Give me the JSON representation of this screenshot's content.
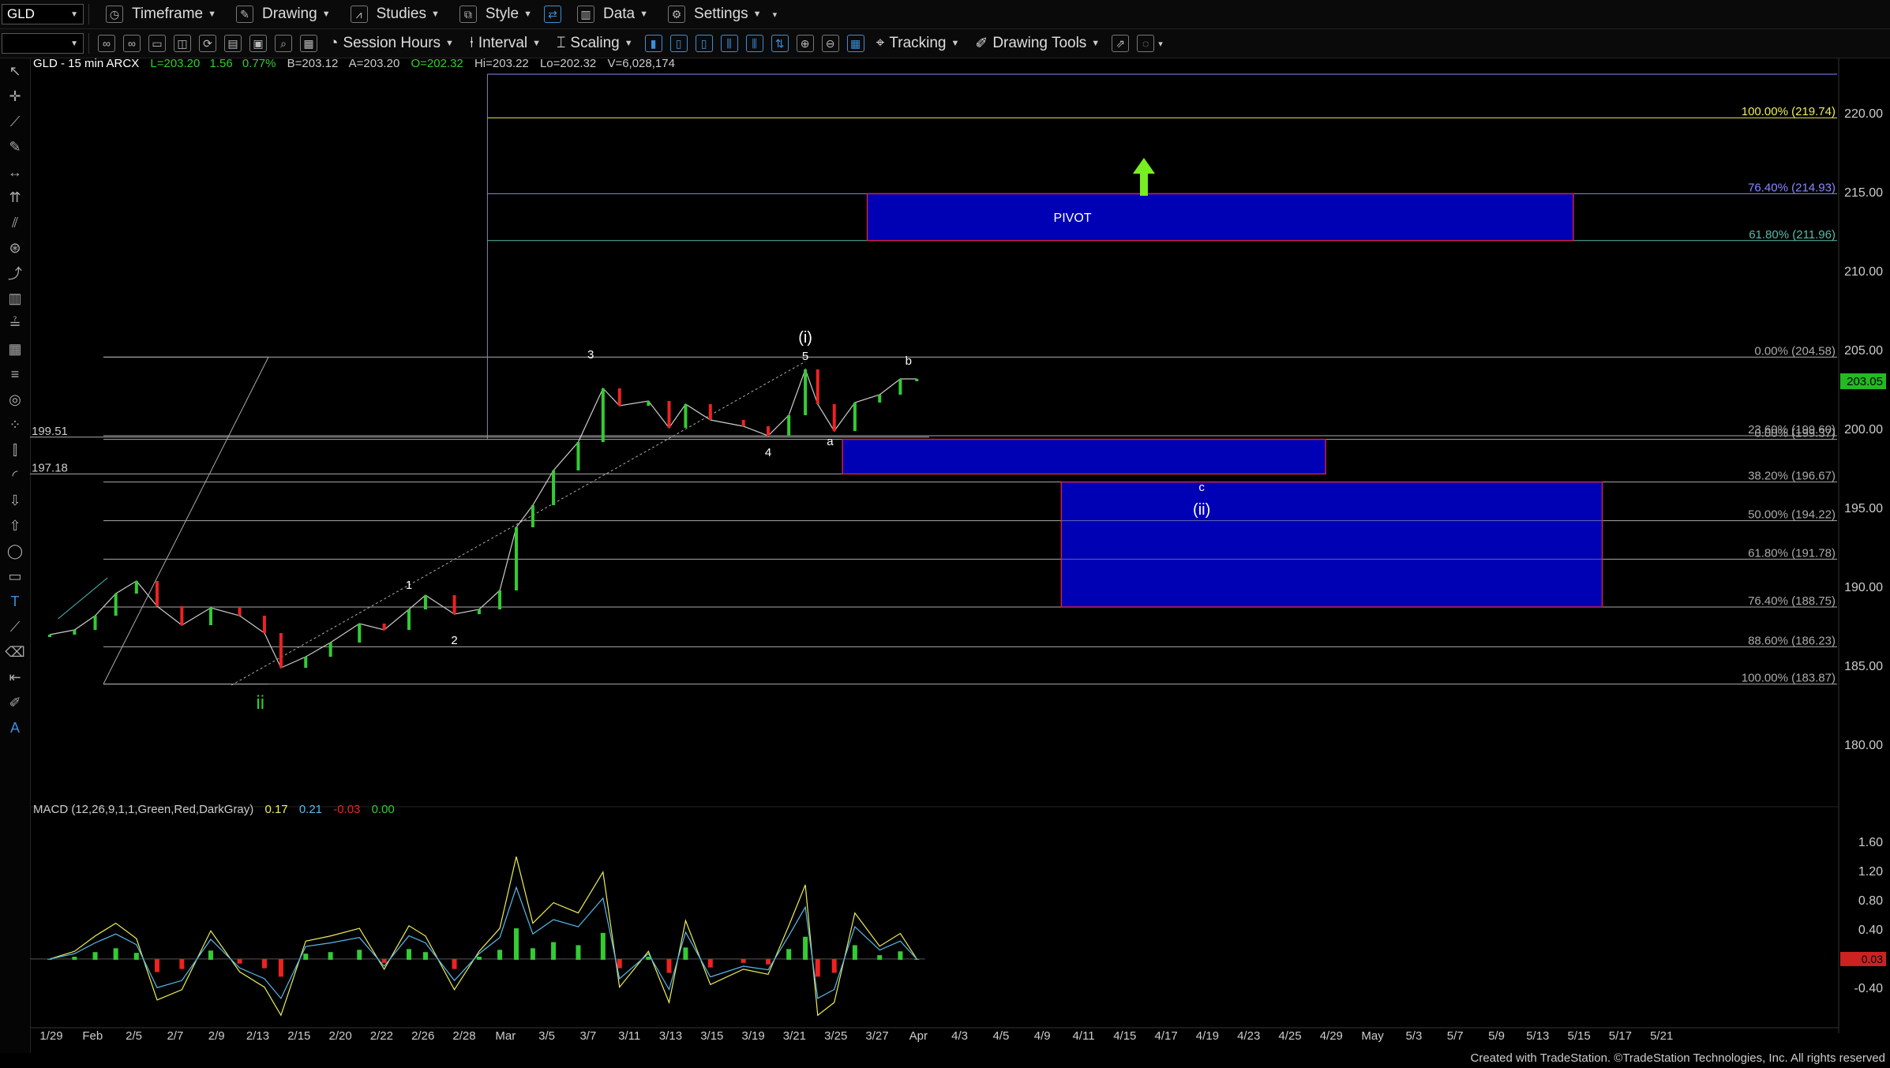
{
  "toolbar1": {
    "symbol": "GLD",
    "items": [
      "Timeframe",
      "Drawing",
      "Studies",
      "Style",
      "Data",
      "Settings"
    ]
  },
  "toolbar2": {
    "items": [
      "Session Hours",
      "Interval",
      "Scaling",
      "Tracking",
      "Drawing Tools"
    ]
  },
  "header": {
    "symbol_line": "GLD - 15 min  ARCX",
    "last": "L=203.20",
    "change": "1.56",
    "change_pct": "0.77%",
    "bid": "B=203.12",
    "ask": "A=203.20",
    "open": "O=202.32",
    "high": "Hi=203.22",
    "low": "Lo=202.32",
    "volume": "V=6,028,174"
  },
  "macd_header": {
    "label": "MACD (12,26,9,1,1,Green,Red,DarkGray)",
    "v1": "0.17",
    "v2": "0.21",
    "v3": "-0.03",
    "v4": "0.00"
  },
  "footer": "Created with TradeStation. ©TradeStation Technologies, Inc. All rights reserved",
  "colors": {
    "up": "#33cc33",
    "down": "#ee2222",
    "accent": "#3b8fd9",
    "box": "#0000b4"
  },
  "chart_data": {
    "type": "line",
    "title": "GLD - 15 min",
    "x_ticks": [
      "1/29",
      "Feb",
      "2/5",
      "2/7",
      "2/9",
      "2/13",
      "2/15",
      "2/20",
      "2/22",
      "2/26",
      "2/28",
      "Mar",
      "3/5",
      "3/7",
      "3/11",
      "3/13",
      "3/15",
      "3/19",
      "3/21",
      "3/25",
      "3/27",
      "Apr",
      "4/3",
      "4/5",
      "4/9",
      "4/11",
      "4/15",
      "4/17",
      "4/19",
      "4/23",
      "4/25",
      "4/29",
      "May",
      "5/3",
      "5/7",
      "5/9",
      "5/13",
      "5/15",
      "5/17",
      "5/21"
    ],
    "y_ticks": [
      220.0,
      215.0,
      210.0,
      205.0,
      200.0,
      195.0,
      190.0,
      185.0,
      180.0
    ],
    "ylim": [
      176.5,
      223.5
    ],
    "macd_ticks": [
      1.6,
      1.2,
      0.8,
      0.4,
      0.0,
      -0.4
    ],
    "macd_ylim": [
      -0.8,
      1.9
    ],
    "last_price_label": "203.05",
    "macd_last_label": "0.03",
    "price_series": [
      {
        "x": 0,
        "y": 187.0
      },
      {
        "x": 0.6,
        "y": 187.3
      },
      {
        "x": 1.1,
        "y": 188.2
      },
      {
        "x": 1.6,
        "y": 189.6
      },
      {
        "x": 2.1,
        "y": 190.4
      },
      {
        "x": 2.6,
        "y": 188.8
      },
      {
        "x": 3.2,
        "y": 187.6
      },
      {
        "x": 3.9,
        "y": 188.7
      },
      {
        "x": 4.6,
        "y": 188.2
      },
      {
        "x": 5.2,
        "y": 187.1
      },
      {
        "x": 5.6,
        "y": 184.9
      },
      {
        "x": 6.2,
        "y": 185.6
      },
      {
        "x": 6.8,
        "y": 186.5
      },
      {
        "x": 7.5,
        "y": 187.7
      },
      {
        "x": 8.1,
        "y": 187.3
      },
      {
        "x": 8.7,
        "y": 188.6
      },
      {
        "x": 9.1,
        "y": 189.5
      },
      {
        "x": 9.8,
        "y": 188.3
      },
      {
        "x": 10.4,
        "y": 188.6
      },
      {
        "x": 10.9,
        "y": 189.8
      },
      {
        "x": 11.3,
        "y": 193.8
      },
      {
        "x": 11.7,
        "y": 195.2
      },
      {
        "x": 12.2,
        "y": 197.4
      },
      {
        "x": 12.8,
        "y": 199.2
      },
      {
        "x": 13.4,
        "y": 202.6
      },
      {
        "x": 13.8,
        "y": 201.5
      },
      {
        "x": 14.5,
        "y": 201.8
      },
      {
        "x": 15.0,
        "y": 200.1
      },
      {
        "x": 15.4,
        "y": 201.6
      },
      {
        "x": 16.0,
        "y": 200.6
      },
      {
        "x": 16.8,
        "y": 200.2
      },
      {
        "x": 17.4,
        "y": 199.6
      },
      {
        "x": 17.9,
        "y": 200.9
      },
      {
        "x": 18.3,
        "y": 203.8
      },
      {
        "x": 18.6,
        "y": 201.6
      },
      {
        "x": 19.0,
        "y": 199.9
      },
      {
        "x": 19.5,
        "y": 201.7
      },
      {
        "x": 20.1,
        "y": 202.2
      },
      {
        "x": 20.6,
        "y": 203.2
      },
      {
        "x": 21.0,
        "y": 203.2
      }
    ],
    "fib_levels": [
      {
        "label": "100.00% (219.74)",
        "value": 219.74,
        "color": "#eeee55"
      },
      {
        "label": "76.40% (214.93)",
        "value": 214.93,
        "color": "#8888ff"
      },
      {
        "label": "61.80% (211.96)",
        "value": 211.96,
        "color": "#55bbaa"
      },
      {
        "label": "0.00% (204.58)",
        "value": 204.58,
        "color": "#aaaaaa"
      },
      {
        "label": "23.60% (199.60)",
        "value": 199.6,
        "color": "#aaaaaa"
      },
      {
        "label": "0.00% (199.37)",
        "value": 199.37,
        "color": "#aaaaaa"
      },
      {
        "label": "38.20% (196.67)",
        "value": 196.67,
        "color": "#aaaaaa"
      },
      {
        "label": "50.00% (194.22)",
        "value": 194.22,
        "color": "#aaaaaa"
      },
      {
        "label": "61.80% (191.78)",
        "value": 191.78,
        "color": "#aaaaaa"
      },
      {
        "label": "76.40% (188.75)",
        "value": 188.75,
        "color": "#aaaaaa"
      },
      {
        "label": "88.60% (186.23)",
        "value": 186.23,
        "color": "#aaaaaa"
      },
      {
        "label": "100.00% (183.87)",
        "value": 183.87,
        "color": "#aaaaaa"
      }
    ],
    "left_levels": [
      {
        "label": "199.51",
        "value": 199.51
      },
      {
        "label": "197.18",
        "value": 197.18
      }
    ],
    "zones": [
      {
        "label": "PIVOT",
        "x0": 19.8,
        "x1": 36.9,
        "y0": 211.96,
        "y1": 214.93
      },
      {
        "label": "",
        "x0": 19.2,
        "x1": 30.9,
        "y0": 197.18,
        "y1": 199.37
      },
      {
        "label": "",
        "x0": 24.5,
        "x1": 37.6,
        "y0": 188.75,
        "y1": 196.67
      }
    ],
    "annotations": [
      {
        "text": "3",
        "x": 13.1,
        "y": 204.5,
        "color": "#ffffff",
        "size": 15
      },
      {
        "text": "(i)",
        "x": 18.3,
        "y": 205.5,
        "color": "#ffffff",
        "size": 20
      },
      {
        "text": "5",
        "x": 18.3,
        "y": 204.4,
        "color": "#ffffff",
        "size": 15
      },
      {
        "text": "b",
        "x": 20.8,
        "y": 204.1,
        "color": "#ffffff",
        "size": 15
      },
      {
        "text": "4",
        "x": 17.4,
        "y": 198.3,
        "color": "#ffffff",
        "size": 15
      },
      {
        "text": "a",
        "x": 18.9,
        "y": 199.0,
        "color": "#ffffff",
        "size": 15
      },
      {
        "text": "1",
        "x": 8.7,
        "y": 189.9,
        "color": "#ffffff",
        "size": 15
      },
      {
        "text": "2",
        "x": 9.8,
        "y": 186.4,
        "color": "#ffffff",
        "size": 15
      },
      {
        "text": "ii",
        "x": 5.1,
        "y": 182.3,
        "color": "#33cc33",
        "size": 24
      },
      {
        "text": "c",
        "x": 27.9,
        "y": 196.1,
        "color": "#ffffff",
        "size": 15
      },
      {
        "text": "(ii)",
        "x": 27.9,
        "y": 194.6,
        "color": "#ffffff",
        "size": 20
      }
    ]
  }
}
